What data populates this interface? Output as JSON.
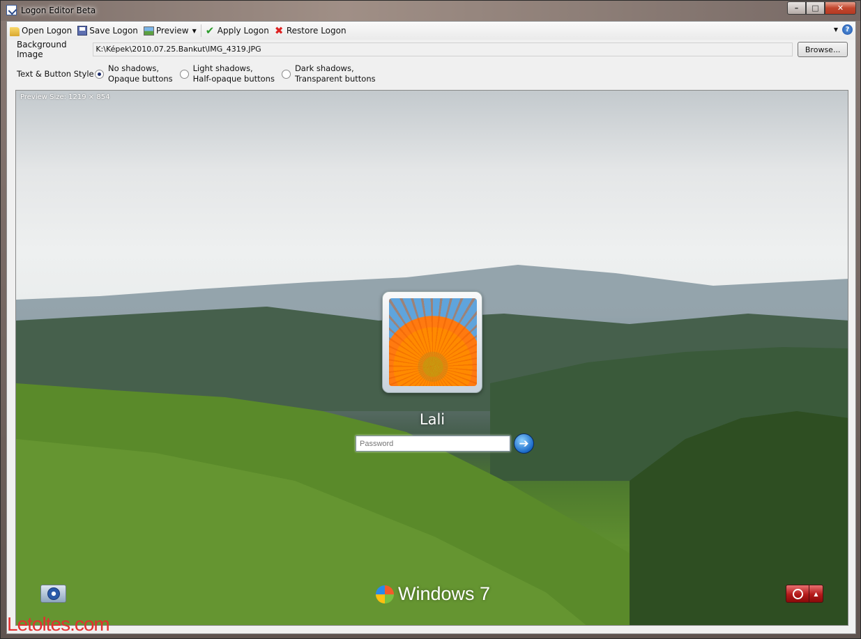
{
  "window": {
    "title": "Logon Editor Beta"
  },
  "toolbar": {
    "open_label": "Open Logon",
    "save_label": "Save Logon",
    "preview_label": "Preview",
    "apply_label": "Apply Logon",
    "restore_label": "Restore Logon"
  },
  "background": {
    "label": "Background Image",
    "path": "K:\\Képek\\2010.07.25.Bankut\\IMG_4319.JPG",
    "browse_label": "Browse..."
  },
  "style": {
    "label": "Text & Button Style",
    "options": [
      {
        "line1": "No shadows,",
        "line2": "Opaque buttons",
        "selected": true
      },
      {
        "line1": "Light shadows,",
        "line2": "Half-opaque buttons",
        "selected": false
      },
      {
        "line1": "Dark shadows,",
        "line2": "Transparent buttons",
        "selected": false
      }
    ]
  },
  "preview": {
    "size_text": "Preview Size: 1219 × 854",
    "username": "Lali",
    "password_placeholder": "Password",
    "os_label": "Windows 7"
  },
  "watermark": "Letoltes.com",
  "icons": {
    "open": "folder-icon",
    "save": "disk-icon",
    "preview": "image-icon",
    "apply": "checkmark-icon",
    "restore": "red-x-icon",
    "help": "help-icon",
    "go": "arrow-right-icon",
    "ease": "ease-of-access-icon",
    "power": "power-icon"
  }
}
